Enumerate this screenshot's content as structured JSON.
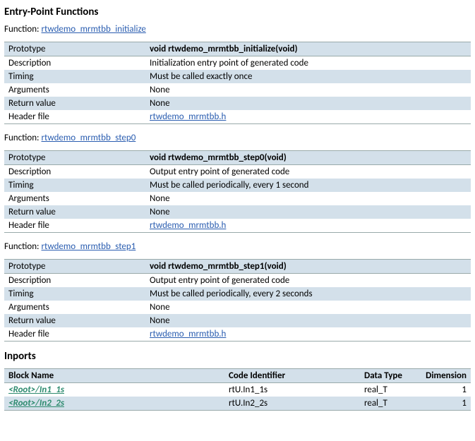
{
  "sections": {
    "entryPoints": "Entry-Point Functions",
    "inports": "Inports"
  },
  "functionLabel": "Function:",
  "functions": [
    {
      "link": "rtwdemo_mrmtbb_initialize",
      "rows": {
        "prototypeLabel": "Prototype",
        "prototypeValue": "void rtwdemo_mrmtbb_initialize(void)",
        "descriptionLabel": "Description",
        "descriptionValue": "Initialization entry point of generated code",
        "timingLabel": "Timing",
        "timingValue": "Must be called exactly once",
        "argumentsLabel": "Arguments",
        "argumentsValue": "None",
        "returnLabel": "Return value",
        "returnValue": "None",
        "headerLabel": "Header file",
        "headerValue": "rtwdemo_mrmtbb.h"
      }
    },
    {
      "link": "rtwdemo_mrmtbb_step0",
      "rows": {
        "prototypeLabel": "Prototype",
        "prototypeValue": "void rtwdemo_mrmtbb_step0(void)",
        "descriptionLabel": "Description",
        "descriptionValue": "Output entry point of generated code",
        "timingLabel": "Timing",
        "timingValue": "Must be called periodically, every 1 second",
        "argumentsLabel": "Arguments",
        "argumentsValue": "None",
        "returnLabel": "Return value",
        "returnValue": "None",
        "headerLabel": "Header file",
        "headerValue": "rtwdemo_mrmtbb.h"
      }
    },
    {
      "link": "rtwdemo_mrmtbb_step1",
      "rows": {
        "prototypeLabel": "Prototype",
        "prototypeValue": "void rtwdemo_mrmtbb_step1(void)",
        "descriptionLabel": "Description",
        "descriptionValue": "Output entry point of generated code",
        "timingLabel": "Timing",
        "timingValue": "Must be called periodically, every 2 seconds",
        "argumentsLabel": "Arguments",
        "argumentsValue": "None",
        "returnLabel": "Return value",
        "returnValue": "None",
        "headerLabel": "Header file",
        "headerValue": "rtwdemo_mrmtbb.h"
      }
    }
  ],
  "ports": {
    "headers": {
      "blockName": "Block Name",
      "codeId": "Code Identifier",
      "dataType": "Data Type",
      "dimension": "Dimension"
    },
    "rows": [
      {
        "name": "<Root>/In1_1s",
        "code": "rtU.In1_1s",
        "type": "real_T",
        "dim": "1"
      },
      {
        "name": "<Root>/In2_2s",
        "code": "rtU.In2_2s",
        "type": "real_T",
        "dim": "1"
      }
    ]
  }
}
